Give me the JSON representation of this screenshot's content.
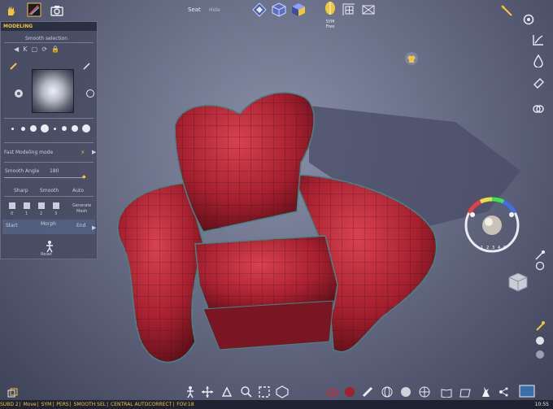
{
  "top": {
    "object_name": "Seat",
    "hide_label": "Hide",
    "sym_label": "SYM",
    "free_label": "Free",
    "icons": [
      "hand-icon",
      "brush-tool-icon",
      "camera-icon",
      "view-front-icon",
      "view-cube-icon",
      "view-shaded-icon",
      "symmetry-mask-icon",
      "grid-icon",
      "scene-icon"
    ]
  },
  "panel": {
    "title": "MODELING",
    "smooth_selection": "Smooth selection",
    "fast_mode": "Fast Modeling mode",
    "smooth_angle_label": "Smooth Angle",
    "smooth_angle_value": "180",
    "sharp": "Sharp",
    "smooth": "Smooth",
    "auto": "Auto",
    "subdiv_levels": [
      "0",
      "1",
      "2",
      "3"
    ],
    "generate_label": "Generate",
    "mesh_label": "Mesh",
    "start": "Start",
    "morph": "Morph",
    "end": "End",
    "reset": "Reset"
  },
  "status": {
    "items": [
      "SUBD 2",
      "Move",
      "SYM",
      "PERS",
      "SMOOTH SEL",
      "CENTRAL AUTOCORRECT",
      "FOV:18"
    ],
    "clock": "10:55"
  },
  "color_wheel": {
    "numbers": [
      "1",
      "2",
      "3",
      "4",
      "5"
    ]
  },
  "colors": {
    "accent": "#f2c53a",
    "model": "#b8283a",
    "panel": "#464a60"
  }
}
